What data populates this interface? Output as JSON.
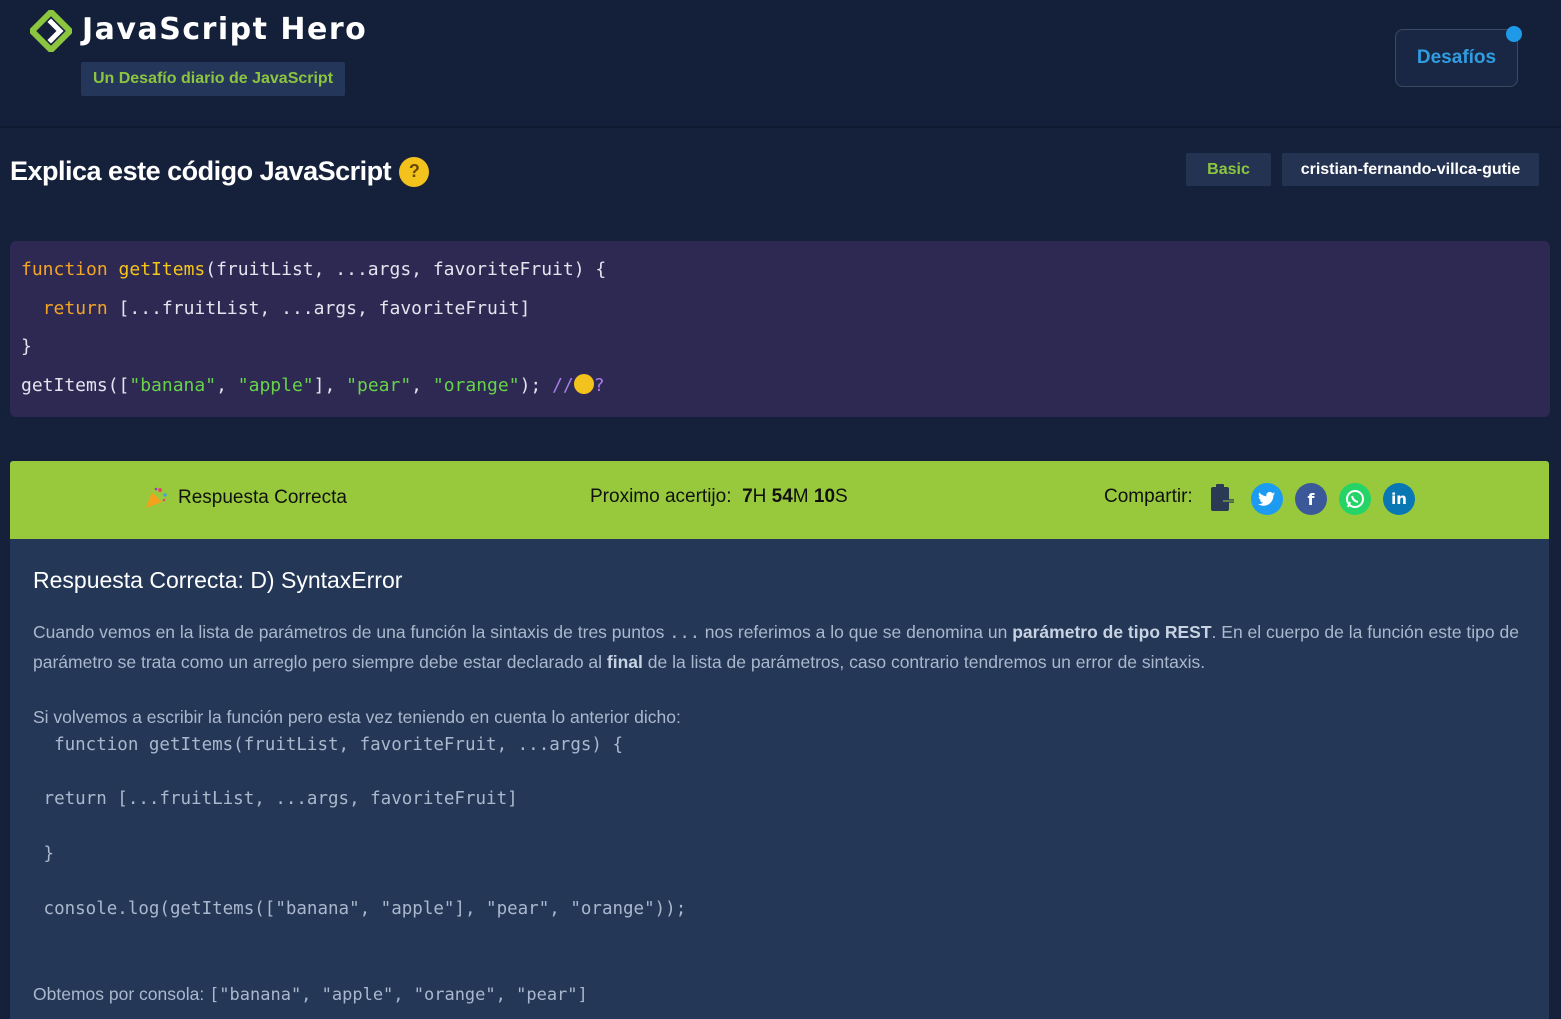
{
  "header": {
    "brand": "JavaScript Hero",
    "tagline": "Un Desafío diario de JavaScript",
    "nav_button": "Desafíos"
  },
  "challenge": {
    "title": "Explica este código JavaScript",
    "level": "Basic",
    "author": "cristian-fernando-villca-gutie",
    "code": {
      "l1_kw": "function",
      "l1_fn": "getItems",
      "l1_rest": "(fruitList, ...args, favoriteFruit) {",
      "l2_kw": "return",
      "l2_rest": " [...fruitList, ...args, favoriteFruit]",
      "l3": "}",
      "l4_a": "getItems([",
      "l4_s1": "\"banana\"",
      "l4_c1": ", ",
      "l4_s2": "\"apple\"",
      "l4_c2": "], ",
      "l4_s3": "\"pear\"",
      "l4_c3": ", ",
      "l4_s4": "\"orange\"",
      "l4_c4": "); ",
      "l4_comment": "//",
      "l4_q": "?"
    }
  },
  "result_bar": {
    "status": "Respuesta Correcta",
    "next_label": "Proximo acertijo:",
    "timer": {
      "h": "7",
      "h_unit": "H",
      "m": "54",
      "m_unit": "M",
      "s": "10",
      "s_unit": "S"
    },
    "share_label": "Compartir:",
    "share_icons": [
      "clipboard-icon",
      "twitter-icon",
      "facebook-icon",
      "whatsapp-icon",
      "linkedin-icon"
    ]
  },
  "explanation": {
    "title": "Respuesta Correcta: D) SyntaxError",
    "p1_a": "Cuando vemos en la lista de parámetros de una función la sintaxis de tres puntos ",
    "p1_dots": "...",
    "p1_b": " nos referimos a lo que se denomina un ",
    "p1_bold1": "parámetro de tipo REST",
    "p1_c": ". En el cuerpo de la función este tipo de parámetro se trata como un arreglo pero siempre debe estar declarado al ",
    "p1_bold2": "final",
    "p1_d": " de la lista de parámetros, caso contrario tendremos un error de sintaxis.",
    "p2": "Si volvemos a escribir la función pero esta vez teniendo en cuenta lo anterior dicho:",
    "code_l1": "  function getItems(fruitList, favoriteFruit, ...args) {",
    "code_l2": " return [...fruitList, ...args, favoriteFruit]",
    "code_l3": " }",
    "code_l4": " console.log(getItems([\"banana\", \"apple\"], \"pear\", \"orange\"));",
    "p3_label": "Obtemos por consola: ",
    "p3_value": "[\"banana\", \"apple\", \"orange\", \"pear\"]"
  },
  "colors": {
    "background": "#15203a",
    "accent_green": "#8cc63f",
    "result_bar": "#98c93c",
    "code_bg": "#2e2953",
    "link_blue": "#2f9de0"
  }
}
